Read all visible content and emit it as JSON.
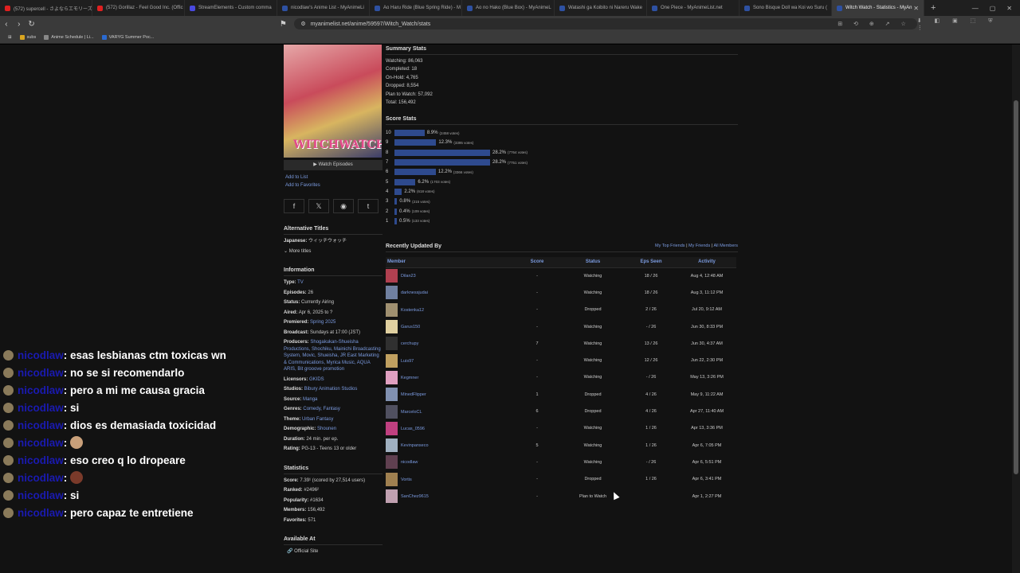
{
  "tabs": [
    {
      "label": "(572) supercell - さよならエモリーズ - Y",
      "color": "#e02020"
    },
    {
      "label": "(572) Gorillaz - Feel Good Inc. (Offic",
      "color": "#e02020"
    },
    {
      "label": "StreamElements - Custom comma",
      "color": "#4a4ae0"
    },
    {
      "label": "nicodlaw's Anime List - MyAnimeLi",
      "color": "#2e51a2"
    },
    {
      "label": "Ao Haru Ride (Blue Spring Ride) - M",
      "color": "#2e51a2"
    },
    {
      "label": "Ao no Hako (Blue Box) - MyAnimeL",
      "color": "#2e51a2"
    },
    {
      "label": "Watashi ga Koibito ni Nareru Wake",
      "color": "#2e51a2"
    },
    {
      "label": "One Piece - MyAnimeList.net",
      "color": "#2e51a2"
    },
    {
      "label": "Sono Bisque Doll wa Koi wo Suru (",
      "color": "#2e51a2"
    },
    {
      "label": "Witch Watch - Statistics - MyAn",
      "color": "#2e51a2",
      "active": true
    }
  ],
  "url": "myanimelist.net/anime/59597/Witch_Watch/stats",
  "bookmarks": [
    {
      "label": "subs",
      "color": "#d9a520"
    },
    {
      "label": "Anime Schedule | Li...",
      "color": "#888"
    },
    {
      "label": "VARYG Summer Poc...",
      "color": "#2a6ad0"
    }
  ],
  "chat": [
    {
      "user": "nicodlaw",
      "text": ": esas lesbianas ctm toxicas wn"
    },
    {
      "user": "nicodlaw",
      "text": ": no se si recomendarlo"
    },
    {
      "user": "nicodlaw",
      "text": ": pero a mi me causa gracia"
    },
    {
      "user": "nicodlaw",
      "text": ": si"
    },
    {
      "user": "nicodlaw",
      "text": ": dios es demasiada toxicidad"
    },
    {
      "user": "nicodlaw",
      "text": ": ",
      "emote": "#c9a07a"
    },
    {
      "user": "nicodlaw",
      "text": ": eso creo q lo dropeare"
    },
    {
      "user": "nicodlaw",
      "text": ": ",
      "emote": "#7a3a2a"
    },
    {
      "user": "nicodlaw",
      "text": ": si"
    },
    {
      "user": "nicodlaw",
      "text": ": pero capaz te entretiene"
    }
  ],
  "left": {
    "poster_logo": "WITCHWATCH",
    "watch_episodes": "Watch Episodes",
    "add_to_list": "Add to List",
    "add_to_favorites": "Add to Favorites",
    "alt_titles_head": "Alternative Titles",
    "japanese_label": "Japanese:",
    "japanese_value": "ウィッチウォッチ",
    "more_titles": "More titles",
    "info_head": "Information",
    "info": [
      {
        "label": "Type:",
        "value": "TV",
        "link": true
      },
      {
        "label": "Episodes:",
        "value": "26",
        "link": false
      },
      {
        "label": "Status:",
        "value": "Currently Airing",
        "link": false
      },
      {
        "label": "Aired:",
        "value": "Apr 6, 2025 to ?",
        "link": false
      },
      {
        "label": "Premiered:",
        "value": "Spring 2025",
        "link": true
      },
      {
        "label": "Broadcast:",
        "value": "Sundays at 17:00 (JST)",
        "link": false
      },
      {
        "label": "Producers:",
        "value": "Shogakukan-Shueisha Productions, Shochiku, Mainichi Broadcasting System, Movic, Shueisha, JR East Marketing & Communications, Myrica Music, AQUA ARIS, Bit grooove promotion",
        "link": true
      },
      {
        "label": "Licensors:",
        "value": "GKIDS",
        "link": true
      },
      {
        "label": "Studios:",
        "value": "Bibury Animation Studios",
        "link": true
      },
      {
        "label": "Source:",
        "value": "Manga",
        "link": true
      },
      {
        "label": "Genres:",
        "value": "Comedy, Fantasy",
        "link": true
      },
      {
        "label": "Theme:",
        "value": "Urban Fantasy",
        "link": true
      },
      {
        "label": "Demographic:",
        "value": "Shounen",
        "link": true
      },
      {
        "label": "Duration:",
        "value": "24 min. per ep.",
        "link": false
      },
      {
        "label": "Rating:",
        "value": "PG-13 - Teens 13 or older",
        "link": false
      }
    ],
    "stats_head": "Statistics",
    "stats": [
      {
        "label": "Score:",
        "value": "7.39¹ (scored by 27,514 users)"
      },
      {
        "label": "Ranked:",
        "value": "#2496²"
      },
      {
        "label": "Popularity:",
        "value": "#1634"
      },
      {
        "label": "Members:",
        "value": "156,492"
      },
      {
        "label": "Favorites:",
        "value": "571"
      }
    ],
    "available_head": "Available At",
    "official_site": "Official Site"
  },
  "summary": {
    "head": "Summary Stats",
    "rows": [
      {
        "label": "Watching:",
        "value": "86,063"
      },
      {
        "label": "Completed:",
        "value": "18"
      },
      {
        "label": "On-Hold:",
        "value": "4,765"
      },
      {
        "label": "Dropped:",
        "value": "8,554"
      },
      {
        "label": "Plan to Watch:",
        "value": "57,092"
      },
      {
        "label": "Total:",
        "value": "156,492"
      }
    ]
  },
  "score_stats": {
    "head": "Score Stats",
    "rows": [
      {
        "score": "10",
        "pct": 8.9,
        "pct_label": "8.9%",
        "votes": "(2458 votes)"
      },
      {
        "score": "9",
        "pct": 12.3,
        "pct_label": "12.3%",
        "votes": "(3395 votes)"
      },
      {
        "score": "8",
        "pct": 28.2,
        "pct_label": "28.2%",
        "votes": "(7764 votes)"
      },
      {
        "score": "7",
        "pct": 28.2,
        "pct_label": "28.2%",
        "votes": "(7751 votes)"
      },
      {
        "score": "6",
        "pct": 12.2,
        "pct_label": "12.2%",
        "votes": "(3366 votes)"
      },
      {
        "score": "5",
        "pct": 6.2,
        "pct_label": "6.2%",
        "votes": "(1703 votes)"
      },
      {
        "score": "4",
        "pct": 2.2,
        "pct_label": "2.2%",
        "votes": "(618 votes)"
      },
      {
        "score": "3",
        "pct": 0.8,
        "pct_label": "0.8%",
        "votes": "(215 votes)"
      },
      {
        "score": "2",
        "pct": 0.4,
        "pct_label": "0.4%",
        "votes": "(109 votes)"
      },
      {
        "score": "1",
        "pct": 0.5,
        "pct_label": "0.5%",
        "votes": "(133 votes)"
      }
    ]
  },
  "recent": {
    "head": "Recently Updated By",
    "link_top": "My Top Friends",
    "link_friends": "My Friends",
    "link_all": "All Members",
    "sep": "|",
    "columns": [
      "Member",
      "Score",
      "Status",
      "Eps Seen",
      "Activity"
    ],
    "rows": [
      {
        "member": "Dilan23",
        "score": "-",
        "status": "Watching",
        "eps": "18 / 26",
        "activity": "Aug 4, 12:48 AM",
        "color": "#b04050"
      },
      {
        "member": "darknessjudai",
        "score": "-",
        "status": "Watching",
        "eps": "18 / 26",
        "activity": "Aug 3, 11:12 PM",
        "color": "#7080a0"
      },
      {
        "member": "Kostenka12",
        "score": "-",
        "status": "Dropped",
        "eps": "2 / 26",
        "activity": "Jul 20, 9:12 AM",
        "color": "#a09070"
      },
      {
        "member": "Garus150",
        "score": "-",
        "status": "Watching",
        "eps": "- / 26",
        "activity": "Jun 30, 8:33 PM",
        "color": "#e0d0a0"
      },
      {
        "member": "cerchupy",
        "score": "7",
        "status": "Watching",
        "eps": "13 / 26",
        "activity": "Jun 30, 4:37 AM",
        "color": "#303030"
      },
      {
        "member": "Luis97",
        "score": "-",
        "status": "Watching",
        "eps": "12 / 26",
        "activity": "Jun 22, 2:30 PM",
        "color": "#c0a060"
      },
      {
        "member": "Kegmner",
        "score": "-",
        "status": "Watching",
        "eps": "- / 26",
        "activity": "May 13, 3:26 PM",
        "color": "#e0a0c0"
      },
      {
        "member": "MinedFlipper",
        "score": "1",
        "status": "Dropped",
        "eps": "4 / 26",
        "activity": "May 9, 11:22 AM",
        "color": "#8090b0"
      },
      {
        "member": "MarceloCL",
        "score": "6",
        "status": "Dropped",
        "eps": "4 / 26",
        "activity": "Apr 27, 11:40 AM",
        "color": "#505060"
      },
      {
        "member": "Lucas_0596",
        "score": "-",
        "status": "Watching",
        "eps": "1 / 26",
        "activity": "Apr 13, 3:36 PM",
        "color": "#c04080"
      },
      {
        "member": "Kevinpanseco",
        "score": "5",
        "status": "Watching",
        "eps": "1 / 26",
        "activity": "Apr 6, 7:05 PM",
        "color": "#a0b0c0"
      },
      {
        "member": "nicodlaw",
        "score": "-",
        "status": "Watching",
        "eps": "- / 26",
        "activity": "Apr 6, 5:51 PM",
        "color": "#604050"
      },
      {
        "member": "Vortis",
        "score": "-",
        "status": "Dropped",
        "eps": "1 / 26",
        "activity": "Apr 6, 3:41 PM",
        "color": "#a08050"
      },
      {
        "member": "SanChez9615",
        "score": "-",
        "status": "Plan to Watch",
        "eps": "",
        "activity": "Apr 1, 2:27 PM",
        "color": "#c0a0b0"
      }
    ]
  }
}
